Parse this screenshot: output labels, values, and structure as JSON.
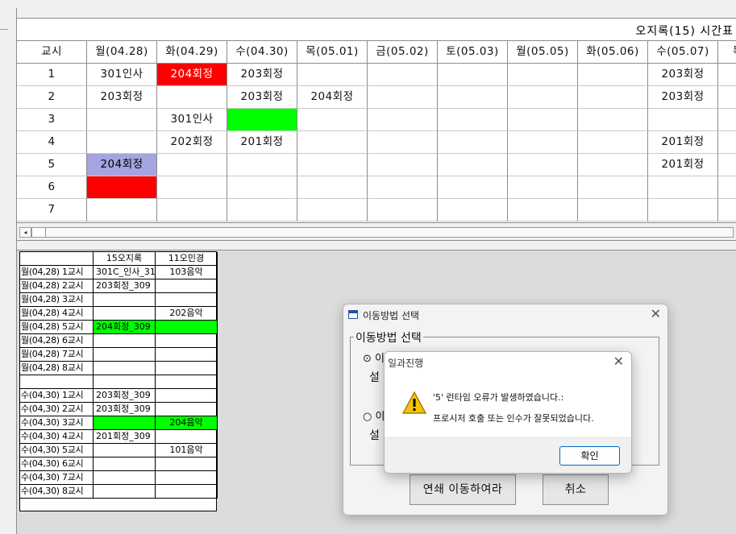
{
  "timetable": {
    "title": "오지록(15) 시간표",
    "header_label": "교시",
    "columns": [
      "월(04.28)",
      "화(04.29)",
      "수(04.30)",
      "목(05.01)",
      "금(05.02)",
      "토(05.03)",
      "월(05.05)",
      "화(05.06)",
      "수(05.07)",
      "목"
    ],
    "periods": [
      "1",
      "2",
      "3",
      "4",
      "5",
      "6",
      "7"
    ],
    "cells": [
      [
        "301인사",
        "204회정",
        "203회정",
        "",
        "",
        "",
        "",
        "",
        "203회정",
        ""
      ],
      [
        "203회정",
        "",
        "203회정",
        "204회정",
        "",
        "",
        "",
        "",
        "203회정",
        ""
      ],
      [
        "",
        "301인사",
        "",
        "",
        "",
        "",
        "",
        "",
        "",
        ""
      ],
      [
        "",
        "202회정",
        "201회정",
        "",
        "",
        "",
        "",
        "",
        "201회정",
        ""
      ],
      [
        "204회정",
        "",
        "",
        "",
        "",
        "",
        "",
        "",
        "201회정",
        ""
      ],
      [
        "",
        "",
        "",
        "",
        "",
        "",
        "",
        "",
        "",
        ""
      ],
      [
        "",
        "",
        "",
        "",
        "",
        "",
        "",
        "",
        "",
        ""
      ]
    ],
    "highlights": [
      {
        "row": 0,
        "col": 1,
        "color": "#ff0000",
        "text_color": "#ffffff"
      },
      {
        "row": 2,
        "col": 2,
        "color": "#00ff00",
        "text_color": "#000000"
      },
      {
        "row": 4,
        "col": 0,
        "color": "#a4a4e0",
        "text_color": "#000000"
      },
      {
        "row": 5,
        "col": 0,
        "color": "#ff0000",
        "text_color": "#000000"
      }
    ]
  },
  "scrollbar": {
    "left_arrow": "◂"
  },
  "compare_table": {
    "headers": [
      "",
      "15오지록",
      "11오민경"
    ],
    "rows": [
      {
        "label": "월(04,28) 1교시",
        "a": "301C_인사_31",
        "b": "103음악",
        "hl": ""
      },
      {
        "label": "월(04,28) 2교시",
        "a": "203회정_309",
        "b": "",
        "hl": ""
      },
      {
        "label": "월(04,28) 3교시",
        "a": "",
        "b": "",
        "hl": ""
      },
      {
        "label": "월(04,28) 4교시",
        "a": "",
        "b": "202음악",
        "hl": ""
      },
      {
        "label": "월(04,28) 5교시",
        "a": "204회정_309",
        "b": "",
        "hl": "#00ff00"
      },
      {
        "label": "월(04,28) 6교시",
        "a": "",
        "b": "",
        "hl": ""
      },
      {
        "label": "월(04,28) 7교시",
        "a": "",
        "b": "",
        "hl": ""
      },
      {
        "label": "월(04,28) 8교시",
        "a": "",
        "b": "",
        "hl": ""
      },
      {
        "label": "",
        "a": "",
        "b": "",
        "hl": ""
      },
      {
        "label": "수(04,30) 1교시",
        "a": "203회정_309",
        "b": "",
        "hl": ""
      },
      {
        "label": "수(04,30) 2교시",
        "a": "203회정_309",
        "b": "",
        "hl": ""
      },
      {
        "label": "수(04,30) 3교시",
        "a": "",
        "b": "204음악",
        "hl": "#00ff00"
      },
      {
        "label": "수(04,30) 4교시",
        "a": "201회정_309",
        "b": "",
        "hl": ""
      },
      {
        "label": "수(04,30) 5교시",
        "a": "",
        "b": "101음악",
        "hl": ""
      },
      {
        "label": "수(04,30) 6교시",
        "a": "",
        "b": "",
        "hl": ""
      },
      {
        "label": "수(04,30) 7교시",
        "a": "",
        "b": "",
        "hl": ""
      },
      {
        "label": "수(04,30) 8교시",
        "a": "",
        "b": "",
        "hl": ""
      }
    ]
  },
  "move_dialog": {
    "title": "이동방법 선택",
    "close": "✕",
    "group_label": "이동방법 선택",
    "option1_prefix": "⊙ 이",
    "option1_line2": "설",
    "option2_prefix": "○ 이",
    "option2_line2": "설",
    "chain_button": "연쇄 이동하여라",
    "cancel_button": "취소"
  },
  "error_dialog": {
    "title": "일과진행",
    "close": "✕",
    "message1": "'5' 런타임 오류가 발생하였습니다.:",
    "message2": "프로시저 호출 또는 인수가 잘못되었습니다.",
    "ok_button": "확인",
    "icon": "warning-icon"
  }
}
